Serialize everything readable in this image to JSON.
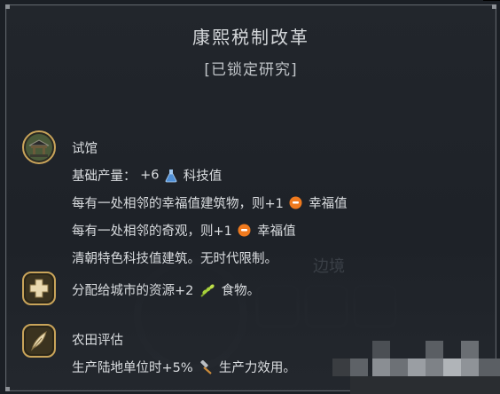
{
  "tooltip": {
    "title": "康熙税制改革",
    "subtitle": "[已锁定研究]"
  },
  "building": {
    "name": "试馆",
    "base_label": "基础产量：",
    "base_value": "+6",
    "base_resource": "科技值",
    "adj_building_text": "每有一处相邻的幸福值建筑物，则+1",
    "adj_building_resource": "幸福值",
    "adj_wonder_text": "每有一处相邻的奇观，则+1",
    "adj_wonder_resource": "幸福值",
    "restriction": "清朝特色科技值建筑。无时代限制。"
  },
  "city_bonus": {
    "text": "分配给城市的资源+2",
    "resource": "食物。"
  },
  "farm": {
    "name": "农田评估",
    "text": "生产陆地单位时+5%",
    "resource": "生产力效用。"
  },
  "background": {
    "ghost_label": "边境"
  },
  "colors": {
    "text": "#d9dcdf",
    "title": "#d4d7da",
    "border": "#5e6369",
    "science": "#6aa7e6",
    "happiness": "#f07a1e",
    "food": "#9ccc3a",
    "icon_gold": "#c9a45a"
  },
  "icons": {
    "building": "pavilion-icon",
    "science": "flask-icon",
    "happiness": "smiley-icon",
    "plus": "plus-icon",
    "food": "wheat-icon",
    "quill": "quill-icon",
    "production": "hammer-icon"
  }
}
